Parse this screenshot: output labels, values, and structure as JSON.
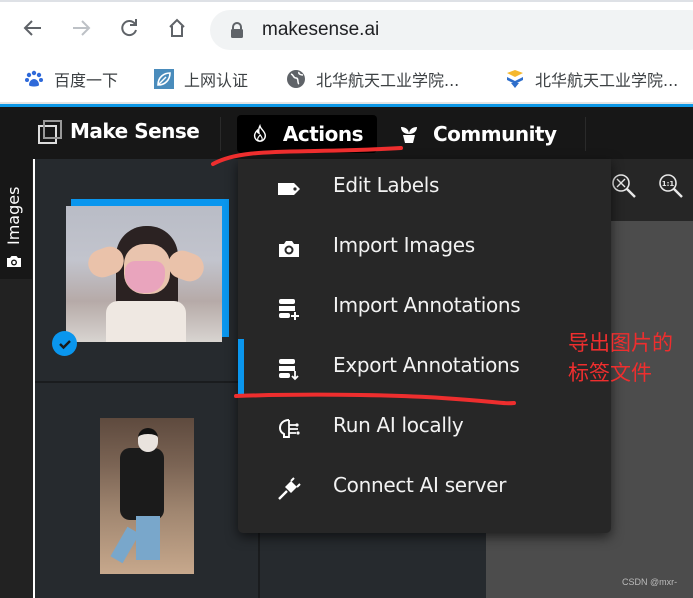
{
  "browser": {
    "url": "makesense.ai",
    "bookmarks": [
      {
        "label": "百度一下",
        "icon": "baidu-paw-icon"
      },
      {
        "label": "上网认证",
        "icon": "leaf-icon"
      },
      {
        "label": "北华航天工业学院...",
        "icon": "globe-icon"
      },
      {
        "label": "北华航天工业学院...",
        "icon": "school-logo-icon"
      }
    ]
  },
  "app": {
    "brand": "Make Sense",
    "nav": {
      "actions": "Actions",
      "community": "Community"
    },
    "sidebar": {
      "images_tab": "Images"
    },
    "images": [
      {
        "name": "girl-with-pink-mask",
        "selected": true
      },
      {
        "name": "person-walking-airport",
        "selected": false
      }
    ],
    "editor_toolbar": [
      {
        "name": "zoom-fit",
        "icon": "zoom-fit-icon"
      },
      {
        "name": "zoom-1-1",
        "icon": "zoom-actual-size-icon",
        "label": "1:1"
      }
    ],
    "actions_menu": [
      {
        "label": "Edit Labels",
        "icon": "tag-icon",
        "active": false
      },
      {
        "label": "Import Images",
        "icon": "camera-icon",
        "active": false
      },
      {
        "label": "Import Annotations",
        "icon": "database-plus-icon",
        "active": false
      },
      {
        "label": "Export Annotations",
        "icon": "database-download-icon",
        "active": true
      },
      {
        "label": "Run AI locally",
        "icon": "ai-brain-icon",
        "active": false
      },
      {
        "label": "Connect AI server",
        "icon": "plug-icon",
        "active": false
      }
    ]
  },
  "annotation": {
    "note": "导出图片的标签文件",
    "color": "#ee2e2e"
  },
  "watermark": "CSDN @mxr-",
  "colors": {
    "accent": "#0a96ee",
    "topbar": "#171717",
    "menu_bg": "#272727",
    "canvas": "#4c4c4c"
  }
}
